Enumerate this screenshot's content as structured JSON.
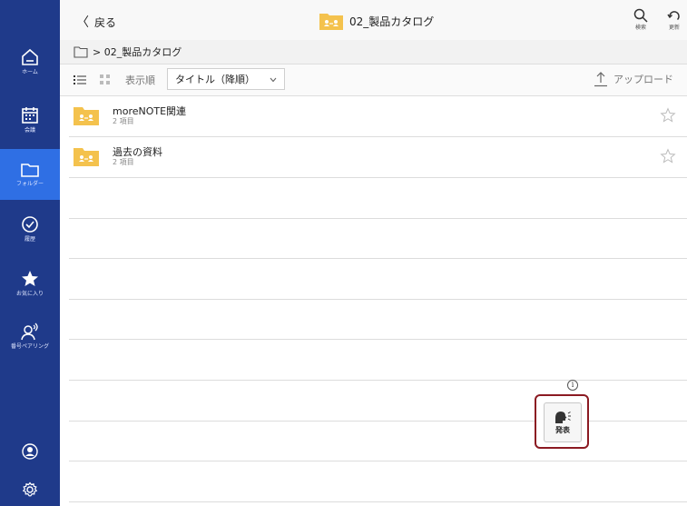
{
  "sidebar": {
    "items": [
      {
        "label": "ホーム",
        "icon": "home-icon"
      },
      {
        "label": "会議",
        "icon": "calendar-icon"
      },
      {
        "label": "フォルダー",
        "icon": "folder-icon"
      },
      {
        "label": "履歴",
        "icon": "history-check-icon"
      },
      {
        "label": "お気に入り",
        "icon": "star-icon"
      },
      {
        "label": "番号ペアリング",
        "icon": "pairing-icon"
      }
    ],
    "bottom": [
      {
        "icon": "user-icon"
      },
      {
        "icon": "settings-gear-icon"
      }
    ]
  },
  "header": {
    "back_label": "戻る",
    "title": "02_製品カタログ",
    "search_label": "検索",
    "refresh_label": "更新"
  },
  "breadcrumb": {
    "path": "> 02_製品カタログ"
  },
  "toolbar": {
    "sort_prefix": "表示順",
    "sort_value": "タイトル（降順）",
    "upload_label": "アップロード"
  },
  "folders": [
    {
      "name": "moreNOTE関連",
      "count": "2 項目"
    },
    {
      "name": "過去の資料",
      "count": "2 項目"
    }
  ],
  "present": {
    "label": "発表"
  },
  "colors": {
    "sidebar_bg": "#1f3a8a",
    "sidebar_active": "#2f6fe4",
    "folder": "#f4c24d",
    "highlight": "#8b1a22"
  }
}
